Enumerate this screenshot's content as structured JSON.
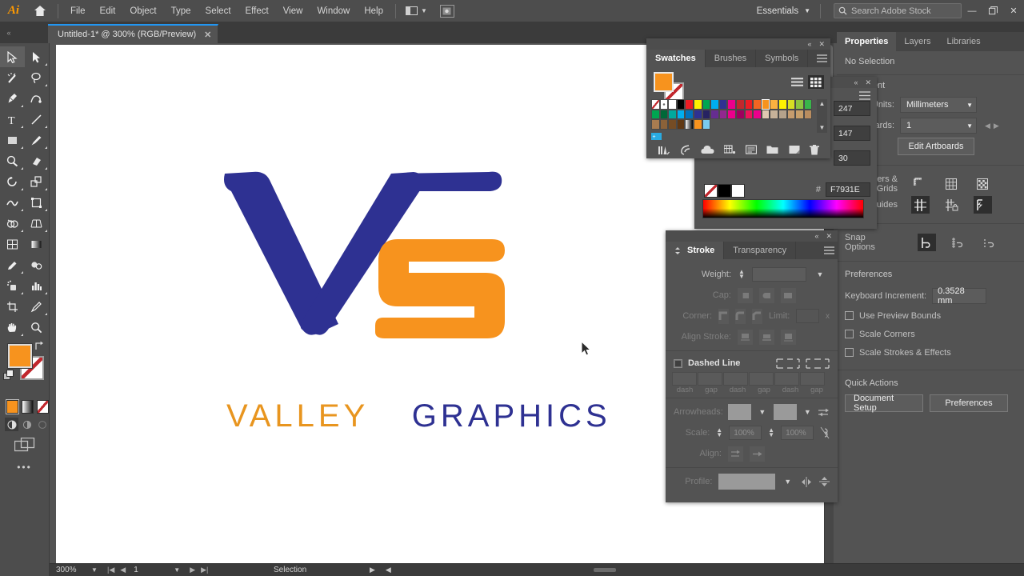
{
  "app": {
    "name": "Adobe Illustrator",
    "logo_text": "Ai",
    "workspace": "Essentials",
    "search_placeholder": "Search Adobe Stock"
  },
  "menu": {
    "items": [
      "File",
      "Edit",
      "Object",
      "Type",
      "Select",
      "Effect",
      "View",
      "Window",
      "Help"
    ]
  },
  "window_controls": {
    "minimize": "—",
    "restore": "❐",
    "close": "✕"
  },
  "document": {
    "tab_title": "Untitled-1* @ 300% (RGB/Preview)",
    "close_label": "✕"
  },
  "artwork": {
    "wordmark_part1": "VALLEY",
    "wordmark_part2": "GRAPHICS",
    "color_blue": "#2e3192",
    "color_orange": "#f7931e"
  },
  "swatches_panel": {
    "tabs": [
      "Swatches",
      "Brushes",
      "Symbols"
    ],
    "active_tab": "Swatches",
    "fill_color": "#f7931e",
    "stroke_color": "#ffffff",
    "grid": [
      [
        "none",
        "registration",
        "#ffffff",
        "#000000",
        "#ed1c24",
        "#fff200",
        "#00a651",
        "#00aeef",
        "#2e3192",
        "#ec008c",
        "#c1272d",
        "#ed1c24",
        "#f26522",
        "#f7931e",
        "#fbb040"
      ],
      [
        "#fff200",
        "#d7df23",
        "#8dc63f",
        "#39b54a",
        "#00a651",
        "#006838",
        "#00a99d",
        "#00aeef",
        "#0072bc",
        "#2e3192",
        "#262262",
        "#662d91",
        "#92278f",
        "#ec008c",
        "#9e005d"
      ],
      [
        "#ed145b",
        "#ec008c",
        "#e0c9b1",
        "#c7b299",
        "#b5a28b",
        "#c69c6d",
        "#c89f6a",
        "#b98d5f",
        "#a97c50",
        "#8c6239",
        "#754c24",
        "#603813",
        "#f0f0f0",
        "#f7931e",
        "#7accf0"
      ]
    ],
    "selected_index": 13,
    "toolbar_icons": [
      "library-icon",
      "edit-color-icon",
      "cloud-icon",
      "new-group-icon",
      "options-icon",
      "folder-icon",
      "new-swatch-icon",
      "delete-icon"
    ]
  },
  "color_panel": {
    "r": "247",
    "g": "147",
    "b": "30",
    "hex_label": "#",
    "hex_value": "F7931E",
    "slider_tick": "35"
  },
  "stroke_panel": {
    "tabs": [
      "Stroke",
      "Transparency"
    ],
    "active_tab": "Stroke",
    "weight_label": "Weight:",
    "weight_value": "",
    "cap_label": "Cap:",
    "corner_label": "Corner:",
    "limit_label": "Limit:",
    "limit_unit": "x",
    "align_stroke_label": "Align Stroke:",
    "dashed_line_label": "Dashed Line",
    "dash_labels": [
      "dash",
      "gap",
      "dash",
      "gap",
      "dash",
      "gap"
    ],
    "arrowheads_label": "Arrowheads:",
    "scale_label": "Scale:",
    "scale_value_1": "100%",
    "scale_value_2": "100%",
    "align_label": "Align:",
    "profile_label": "Profile:"
  },
  "properties_panel": {
    "tabs": [
      "Properties",
      "Layers",
      "Libraries"
    ],
    "active_tab": "Properties",
    "selection_status": "No Selection",
    "document_section": "Document",
    "units_label": "Units:",
    "units_value": "Millimeters",
    "artboards_label": "Artboards:",
    "artboards_value": "1",
    "edit_artboards_label": "Edit Artboards",
    "rulers_grids_label": "Rulers & Grids",
    "guides_label": "Guides",
    "snap_options_label": "Snap Options",
    "preferences_section": "Preferences",
    "keyboard_increment_label": "Keyboard Increment:",
    "keyboard_increment_value": "0.3528 mm",
    "checkboxes": [
      {
        "label": "Use Preview Bounds",
        "checked": false
      },
      {
        "label": "Scale Corners",
        "checked": false
      },
      {
        "label": "Scale Strokes & Effects",
        "checked": false
      }
    ],
    "quick_actions_label": "Quick Actions",
    "document_setup_label": "Document Setup",
    "preferences_label": "Preferences"
  },
  "toolbar": {
    "tools": [
      [
        "selection-tool",
        "direct-selection-tool"
      ],
      [
        "magic-wand-tool",
        "lasso-tool"
      ],
      [
        "pen-tool",
        "curvature-tool"
      ],
      [
        "type-tool",
        "line-segment-tool"
      ],
      [
        "rectangle-tool",
        "paintbrush-tool"
      ],
      [
        "shaper-tool",
        "eraser-tool"
      ],
      [
        "rotate-tool",
        "scale-tool"
      ],
      [
        "width-tool",
        "free-transform-tool"
      ],
      [
        "shape-builder-tool",
        "perspective-grid-tool"
      ],
      [
        "mesh-tool",
        "gradient-tool"
      ],
      [
        "eyedropper-tool",
        "blend-tool"
      ],
      [
        "symbol-sprayer-tool",
        "column-graph-tool"
      ],
      [
        "artboard-tool",
        "slice-tool"
      ],
      [
        "hand-tool",
        "zoom-tool"
      ]
    ],
    "fill_color": "#f7931e",
    "stroke_color": "#ffffff",
    "more_tools": "•••"
  },
  "statusbar": {
    "zoom": "300%",
    "page": "1",
    "tool_status": "Selection"
  }
}
